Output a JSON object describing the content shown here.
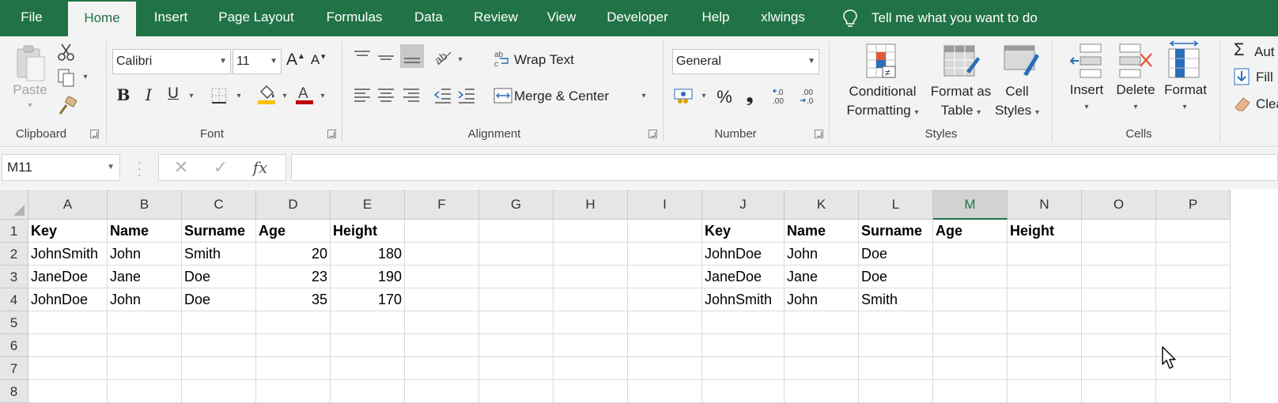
{
  "menu": {
    "tabs": [
      "File",
      "Home",
      "Insert",
      "Page Layout",
      "Formulas",
      "Data",
      "Review",
      "View",
      "Developer",
      "Help",
      "xlwings"
    ],
    "active_tab": "Home",
    "tell_me": "Tell me what you want to do"
  },
  "ribbon": {
    "clipboard": {
      "paste": "Paste",
      "label": "Clipboard"
    },
    "font": {
      "name": "Calibri",
      "size": "11",
      "bold": "B",
      "italic": "I",
      "underline": "U",
      "label": "Font",
      "highlight_color": "#ffc000",
      "font_color": "#c00000"
    },
    "alignment": {
      "wrap_text": "Wrap Text",
      "merge_center": "Merge & Center",
      "label": "Alignment"
    },
    "number": {
      "format": "General",
      "percent": "%",
      "comma": "❟",
      "label": "Number"
    },
    "styles": {
      "conditional": [
        "Conditional",
        "Formatting"
      ],
      "format_table": [
        "Format as",
        "Table"
      ],
      "cell_styles": [
        "Cell",
        "Styles"
      ],
      "label": "Styles"
    },
    "cells": {
      "insert": "Insert",
      "delete": "Delete",
      "format": "Format",
      "label": "Cells"
    },
    "editing": {
      "autosum": "Aut",
      "fill": "Fill",
      "clear": "Clea"
    }
  },
  "formula_bar": {
    "name_box": "M11",
    "formula": ""
  },
  "grid": {
    "columns": [
      "A",
      "B",
      "C",
      "D",
      "E",
      "F",
      "G",
      "H",
      "I",
      "J",
      "K",
      "L",
      "M",
      "N",
      "O",
      "P"
    ],
    "selected_column": "M",
    "rows": [
      "1",
      "2",
      "3",
      "4",
      "5",
      "6",
      "7",
      "8"
    ],
    "table_left": {
      "headers": [
        "Key",
        "Name",
        "Surname",
        "Age",
        "Height"
      ],
      "rows": [
        [
          "JohnSmith",
          "John",
          "Smith",
          "20",
          "180"
        ],
        [
          "JaneDoe",
          "Jane",
          "Doe",
          "23",
          "190"
        ],
        [
          "JohnDoe",
          "John",
          "Doe",
          "35",
          "170"
        ]
      ]
    },
    "table_right": {
      "headers": [
        "Key",
        "Name",
        "Surname",
        "Age",
        "Height"
      ],
      "rows": [
        [
          "JohnDoe",
          "John",
          "Doe"
        ],
        [
          "JaneDoe",
          "Jane",
          "Doe"
        ],
        [
          "JohnSmith",
          "John",
          "Smith"
        ]
      ]
    }
  },
  "colors": {
    "brand": "#217346",
    "ribbon_bg": "#f3f3f3"
  }
}
